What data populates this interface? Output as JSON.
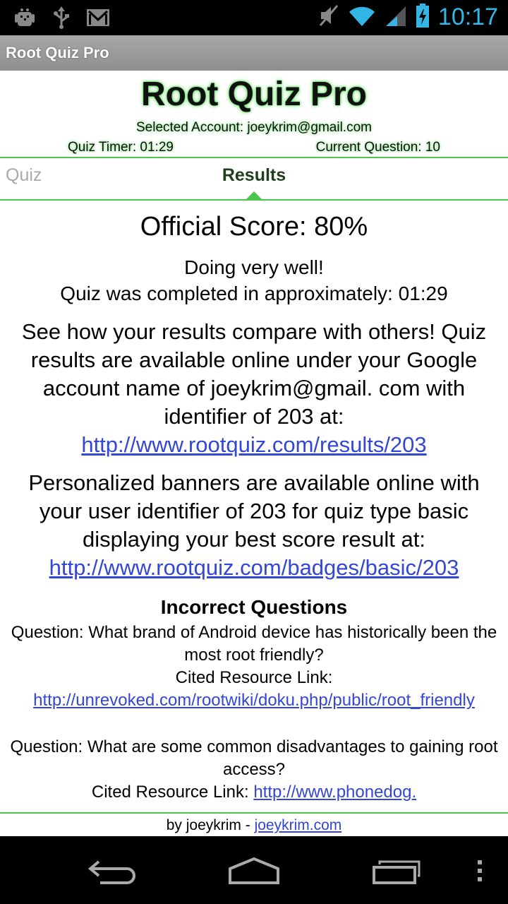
{
  "status_bar": {
    "time": "10:17",
    "left_icons": [
      "android-debug-icon",
      "usb-icon",
      "gmail-icon"
    ],
    "right_icons": [
      "mute-icon",
      "wifi-icon",
      "signal-icon",
      "battery-icon"
    ]
  },
  "action_bar": {
    "title": "Root Quiz Pro"
  },
  "header": {
    "title": "Root Quiz Pro",
    "account": "Selected Account: joeykrim@gmail.com",
    "timer": "Quiz Timer: 01:29",
    "current_question": "Current Question: 10"
  },
  "tabs": {
    "quiz": "Quiz",
    "results": "Results",
    "active": "Results"
  },
  "results": {
    "score": "Official Score: 80%",
    "status": "Doing very well!",
    "completed": "Quiz was completed in approximately: 01:29",
    "compare_text": "See how your results compare with others! Quiz results are available online under your Google account name of joeykrim@gmail. com with identifier of 203 at:",
    "compare_link": "http://www.rootquiz.com/results/203",
    "banner_text": "Personalized banners are available online with your user identifier of 203 for quiz type basic displaying your best score result at:",
    "banner_link": "http://www.rootquiz.com/badges/basic/203",
    "incorrect_heading": "Incorrect Questions",
    "incorrect": [
      {
        "question": "Question: What brand of Android device has historically been the most root friendly?",
        "cited_label": "Cited Resource Link: ",
        "link": "http://unrevoked.com/rootwiki/doku.php/public/root_friendly"
      },
      {
        "question": "Question: What are some common disadvantages to gaining root access?",
        "cited_label": "Cited Resource Link: ",
        "link": "http://www.phonedog."
      }
    ]
  },
  "footer": {
    "prefix": "by joeykrim - ",
    "link": "joeykrim.com"
  },
  "nav_bar": {
    "buttons": [
      "back-icon",
      "home-icon",
      "recent-apps-icon",
      "menu-icon"
    ]
  },
  "colors": {
    "accent_green": "#4cc64c",
    "link_blue": "#3346d6",
    "status_blue": "#33b5e5"
  }
}
